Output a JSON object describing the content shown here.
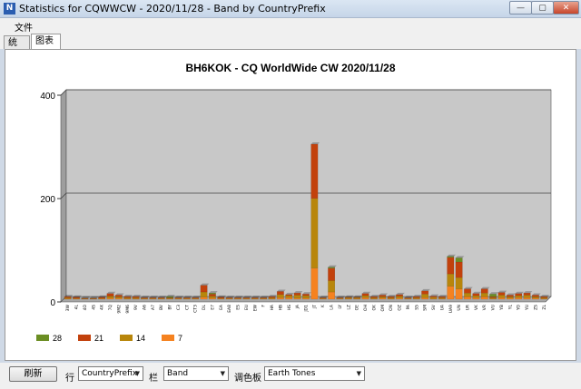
{
  "window": {
    "title": "Statistics for CQWWCW - 2020/11/28 - Band by CountryPrefix",
    "icon_label": "N",
    "buttons": {
      "minimize": "—",
      "maximize": "▢",
      "close": "✕"
    }
  },
  "menu": {
    "file": "文件"
  },
  "tabs": [
    {
      "label": "统计"
    },
    {
      "label": "图表"
    }
  ],
  "toolbar": {
    "refresh_label": "刷新",
    "row_label": "行",
    "row_value": "CountryPrefix",
    "column_label": "栏",
    "column_value": "Band",
    "palette_label": "调色板",
    "palette_value": "Earth Tones"
  },
  "chart_data": {
    "type": "bar",
    "stacked": true,
    "title": "BH6KOK - CQ WorldWide CW 2020/11/28",
    "ylim": [
      0,
      400
    ],
    "yticks": [
      0,
      200,
      400
    ],
    "grid": true,
    "legend_position": "bottom-left",
    "categories": [
      "3W",
      "4L",
      "4O",
      "4S",
      "4X",
      "7Q",
      "9M2",
      "9M6",
      "9V",
      "A6",
      "A7",
      "BV",
      "BY",
      "C3",
      "CT",
      "CT3",
      "DL",
      "E7",
      "EA",
      "EA8",
      "ES",
      "EU",
      "EW",
      "F",
      "HA",
      "HB",
      "HS",
      "JA",
      "JD1",
      "JT",
      "K",
      "LA",
      "LY",
      "LZ",
      "OE",
      "OH",
      "OK",
      "OM",
      "ON",
      "OZ",
      "PA",
      "S5",
      "SM",
      "SV",
      "UA",
      "UA9",
      "UN",
      "UR",
      "VK",
      "VR",
      "VU",
      "YB",
      "YL",
      "YO",
      "YU",
      "ZS",
      "ZL"
    ],
    "series": [
      {
        "name": "28",
        "color": "#6b8e23",
        "values": [
          0,
          0,
          0,
          0,
          0,
          0,
          0,
          0,
          0,
          0,
          0,
          0,
          2,
          0,
          0,
          0,
          0,
          2,
          0,
          0,
          0,
          0,
          0,
          0,
          0,
          0,
          0,
          0,
          0,
          0,
          0,
          2,
          0,
          0,
          0,
          0,
          0,
          0,
          0,
          0,
          0,
          0,
          0,
          0,
          0,
          2,
          8,
          0,
          0,
          0,
          5,
          0,
          0,
          0,
          0,
          0,
          0
        ]
      },
      {
        "name": "21",
        "color": "#c2410c",
        "values": [
          2,
          2,
          1,
          1,
          2,
          5,
          3,
          2,
          2,
          1,
          1,
          1,
          1,
          1,
          1,
          1,
          13,
          4,
          2,
          1,
          1,
          1,
          1,
          1,
          2,
          6,
          2,
          4,
          3,
          105,
          1,
          24,
          1,
          1,
          1,
          4,
          2,
          3,
          2,
          3,
          1,
          2,
          6,
          2,
          2,
          32,
          30,
          8,
          4,
          8,
          2,
          5,
          3,
          4,
          4,
          3,
          2
        ]
      },
      {
        "name": "14",
        "color": "#b8860b",
        "values": [
          2,
          1,
          1,
          1,
          1,
          4,
          3,
          2,
          2,
          1,
          1,
          1,
          1,
          1,
          1,
          1,
          10,
          4,
          1,
          1,
          1,
          1,
          1,
          1,
          2,
          6,
          4,
          6,
          5,
          135,
          1,
          22,
          1,
          2,
          2,
          4,
          2,
          3,
          2,
          4,
          1,
          2,
          7,
          3,
          2,
          24,
          22,
          7,
          4,
          7,
          2,
          5,
          3,
          4,
          5,
          3,
          2
        ]
      },
      {
        "name": "7",
        "color": "#f58220",
        "values": [
          1,
          1,
          0,
          0,
          1,
          2,
          2,
          1,
          1,
          1,
          1,
          1,
          1,
          1,
          1,
          1,
          4,
          2,
          1,
          1,
          1,
          1,
          1,
          1,
          1,
          3,
          3,
          2,
          2,
          60,
          1,
          14,
          1,
          1,
          1,
          3,
          1,
          2,
          1,
          2,
          1,
          1,
          3,
          1,
          1,
          25,
          20,
          5,
          3,
          5,
          1,
          3,
          2,
          3,
          3,
          2,
          1
        ]
      }
    ]
  }
}
